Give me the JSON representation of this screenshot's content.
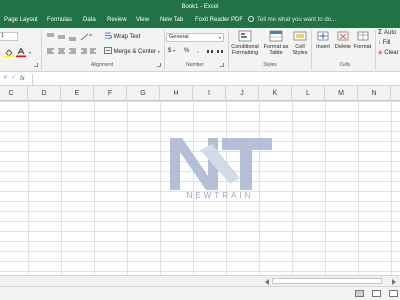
{
  "window": {
    "title": "Book1 - Excel"
  },
  "tabs": [
    "Page Layout",
    "Formulas",
    "Data",
    "Review",
    "View",
    "New Tab",
    "Foxit Reader PDF"
  ],
  "tell_me": "Tell me what you want to do...",
  "ribbon": {
    "font_size": "1",
    "wrap_text": "Wrap Text",
    "merge_center": "Merge & Center",
    "alignment_group": "Alignment",
    "number_format": "General",
    "currency_symbol": "$",
    "percent_symbol": "%",
    "comma_symbol": ",",
    "number_group": "Number",
    "conditional_formatting": [
      "Conditional",
      "Formatting"
    ],
    "format_as_table": [
      "Format as",
      "Table"
    ],
    "cell_styles": [
      "Cell",
      "Styles"
    ],
    "styles_group": "Styles",
    "insert": "Insert",
    "delete": "Delete",
    "format": "Format",
    "cells_group": "Cells",
    "autosum": "Auto",
    "fill": "Fill",
    "clear": "Clear"
  },
  "formula_bar": {
    "fx_label": "fx",
    "value": ""
  },
  "columns": [
    "C",
    "D",
    "E",
    "F",
    "G",
    "H",
    "I",
    "J",
    "K",
    "L",
    "M",
    "N"
  ],
  "watermark": {
    "text": "NEWTRAIN"
  },
  "colors": {
    "accent": "#217346",
    "grid_line": "#e1e1e1",
    "ribbon_bg": "#f3f3f3"
  }
}
